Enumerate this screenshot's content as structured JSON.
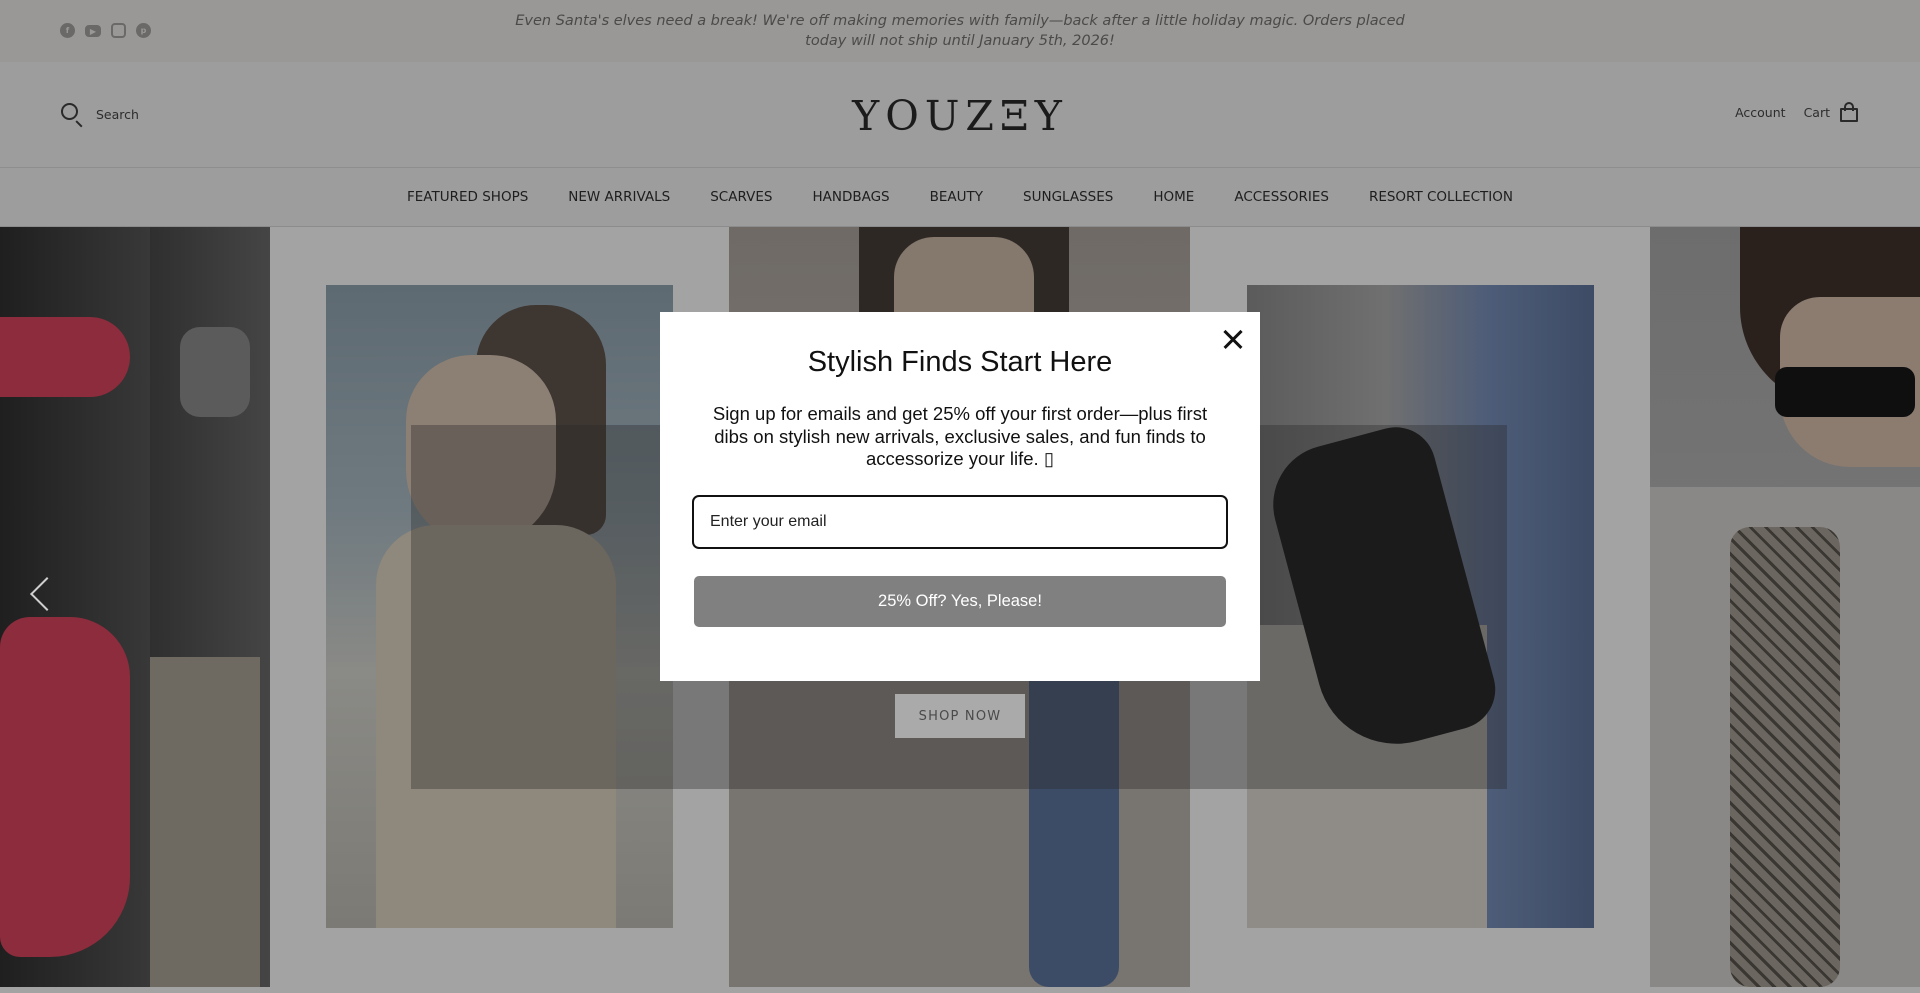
{
  "announcement": {
    "text": "Even Santa's elves need a break! We're off making memories with family—back after a little holiday magic. Orders placed today will not ship until January 5th, 2026!",
    "socials": [
      {
        "icon": "facebook-icon",
        "glyph": "f"
      },
      {
        "icon": "youtube-icon",
        "glyph": "▶"
      },
      {
        "icon": "instagram-icon",
        "glyph": ""
      },
      {
        "icon": "pinterest-icon",
        "glyph": "p"
      }
    ]
  },
  "header": {
    "search_label": "Search",
    "logo": "YOUZΞY",
    "account_label": "Account",
    "cart_label": "Cart"
  },
  "nav": {
    "items": [
      "FEATURED SHOPS",
      "NEW ARRIVALS",
      "SCARVES",
      "HANDBAGS",
      "BEAUTY",
      "SUNGLASSES",
      "HOME",
      "ACCESSORIES",
      "RESORT COLLECTION"
    ]
  },
  "hero": {
    "cta_label": "SHOP NOW",
    "prev_icon": "chevron-left-icon"
  },
  "modal": {
    "title": "Stylish Finds Start Here",
    "body": "Sign up for emails and get 25% off your first order—plus first dibs on stylish new arrivals, exclusive sales, and fun finds to accessorize your life. ▯",
    "email_placeholder": "Enter your email",
    "submit_label": "25% Off? Yes, Please!",
    "close_icon": "close-icon"
  },
  "colors": {
    "announcement_bg": "#9a9896",
    "overlay_header_bg": "#9d9d9d",
    "modal_bg": "#ffffff",
    "submit_bg": "#808080",
    "text_dark": "#111111"
  }
}
